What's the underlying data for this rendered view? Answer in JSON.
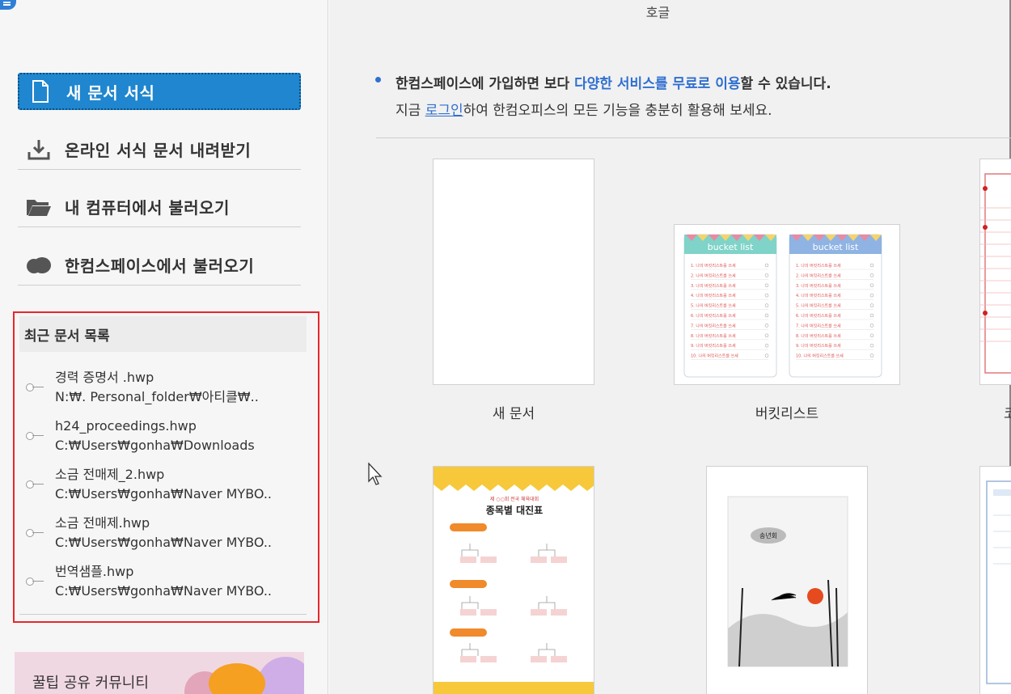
{
  "window": {
    "title": "호글"
  },
  "sidebar": {
    "nav": [
      {
        "label": "새 문서 서식",
        "icon": "new-document-icon"
      },
      {
        "label": "온라인 서식 문서 내려받기",
        "icon": "download-icon"
      },
      {
        "label": "내 컴퓨터에서 불러오기",
        "icon": "folder-icon"
      },
      {
        "label": "한컴스페이스에서 불러오기",
        "icon": "cloud-icon"
      }
    ],
    "recent": {
      "title": "최근 문서 목록",
      "items": [
        {
          "name": "경력 증명서 .hwp",
          "path": "N:₩. Personal_folder₩아티클₩.."
        },
        {
          "name": "h24_proceedings.hwp",
          "path": "C:₩Users₩gonha₩Downloads"
        },
        {
          "name": "소금 전매제_2.hwp",
          "path": "C:₩Users₩gonha₩Naver MYBO.."
        },
        {
          "name": "소금 전매제.hwp",
          "path": "C:₩Users₩gonha₩Naver MYBO.."
        },
        {
          "name": "번역샘플.hwp",
          "path": "C:₩Users₩gonha₩Naver MYBO.."
        }
      ]
    },
    "banner": {
      "text": "꿀팁 공유 커뮤니티"
    }
  },
  "main": {
    "notice": {
      "line1_a": "한컴스페이스에 가입하면 보다 ",
      "line1_b": "다양한 서비스를 무료로 이용",
      "line1_c": "할 수 있습니다.",
      "line2_a": "지금 ",
      "line2_link": "로그인",
      "line2_b": "하여 한컴오피스의 모든 기능을 충분히 활용해 보세요."
    },
    "templates": [
      {
        "label": "새 문서"
      },
      {
        "label": "버킷리스트"
      },
      {
        "label": "코"
      }
    ],
    "bucket": {
      "heading": "bucket list",
      "rows": [
        "1",
        "2",
        "3",
        "4",
        "5",
        "6",
        "7",
        "8",
        "9",
        "10"
      ],
      "row_text": "나의 버킷리스트를 쓰세"
    },
    "tournament": {
      "small_title": "제 ○○회 전국 체육대회",
      "title": "종목별 대진표"
    },
    "ink": {
      "badge": "송년회"
    }
  }
}
